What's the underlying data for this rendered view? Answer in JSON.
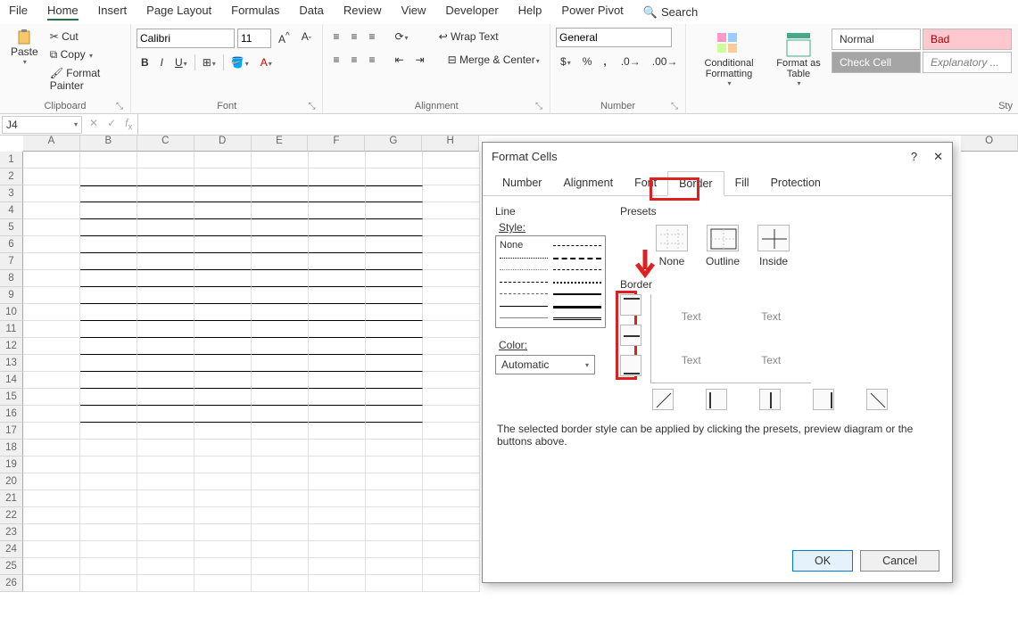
{
  "menu": {
    "items": [
      "File",
      "Home",
      "Insert",
      "Page Layout",
      "Formulas",
      "Data",
      "Review",
      "View",
      "Developer",
      "Help",
      "Power Pivot"
    ],
    "active": "Home",
    "search": "Search"
  },
  "clipboard": {
    "paste": "Paste",
    "cut": "Cut",
    "copy": "Copy",
    "painter": "Format Painter",
    "label": "Clipboard"
  },
  "font": {
    "name": "Calibri",
    "size": "11",
    "label": "Font"
  },
  "alignment": {
    "wrap": "Wrap Text",
    "merge": "Merge & Center",
    "label": "Alignment"
  },
  "number": {
    "format": "General",
    "label": "Number"
  },
  "styles": {
    "cond": "Conditional Formatting",
    "table": "Format as Table",
    "normal": "Normal",
    "bad": "Bad",
    "check": "Check Cell",
    "expl": "Explanatory ...",
    "label": "Sty"
  },
  "namebox": "J4",
  "columns": [
    "A",
    "B",
    "C",
    "D",
    "E",
    "F",
    "G",
    "H",
    "O"
  ],
  "rows_with_borders": {
    "start": 3,
    "end": 16
  },
  "row_count": 26,
  "dialog": {
    "title": "Format Cells",
    "tabs": [
      "Number",
      "Alignment",
      "Font",
      "Border",
      "Fill",
      "Protection"
    ],
    "active_tab": "Border",
    "line": {
      "label": "Line",
      "style": "Style:",
      "none": "None",
      "color": "Color:",
      "color_value": "Automatic"
    },
    "presets": {
      "label": "Presets",
      "none": "None",
      "outline": "Outline",
      "inside": "Inside"
    },
    "border_label": "Border",
    "preview_text": "Text",
    "help": "The selected border style can be applied by clicking the presets, preview diagram or the buttons above.",
    "ok": "OK",
    "cancel": "Cancel"
  }
}
